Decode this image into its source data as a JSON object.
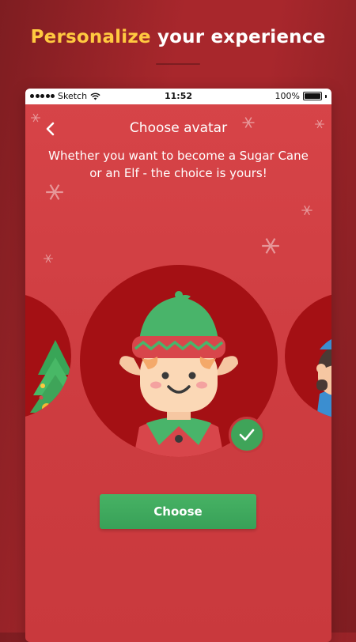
{
  "headline": {
    "accent": "Personalize",
    "rest": " your experience"
  },
  "statusbar": {
    "carrier": "Sketch",
    "time": "11:52",
    "battery": "100%"
  },
  "screen": {
    "title": "Choose avatar",
    "subtitle": "Whether you want to become a Sugar Cane or an Elf - the choice is yours!",
    "choose_label": "Choose"
  },
  "avatars": [
    {
      "name": "christmas-tree-avatar",
      "selected": false
    },
    {
      "name": "elf-avatar",
      "selected": true
    },
    {
      "name": "character-avatar",
      "selected": false
    }
  ],
  "colors": {
    "accent_yellow": "#ffc940",
    "avatar_circle": "#a41014",
    "button_green": "#3fa459",
    "screen_red": "#d04044"
  }
}
